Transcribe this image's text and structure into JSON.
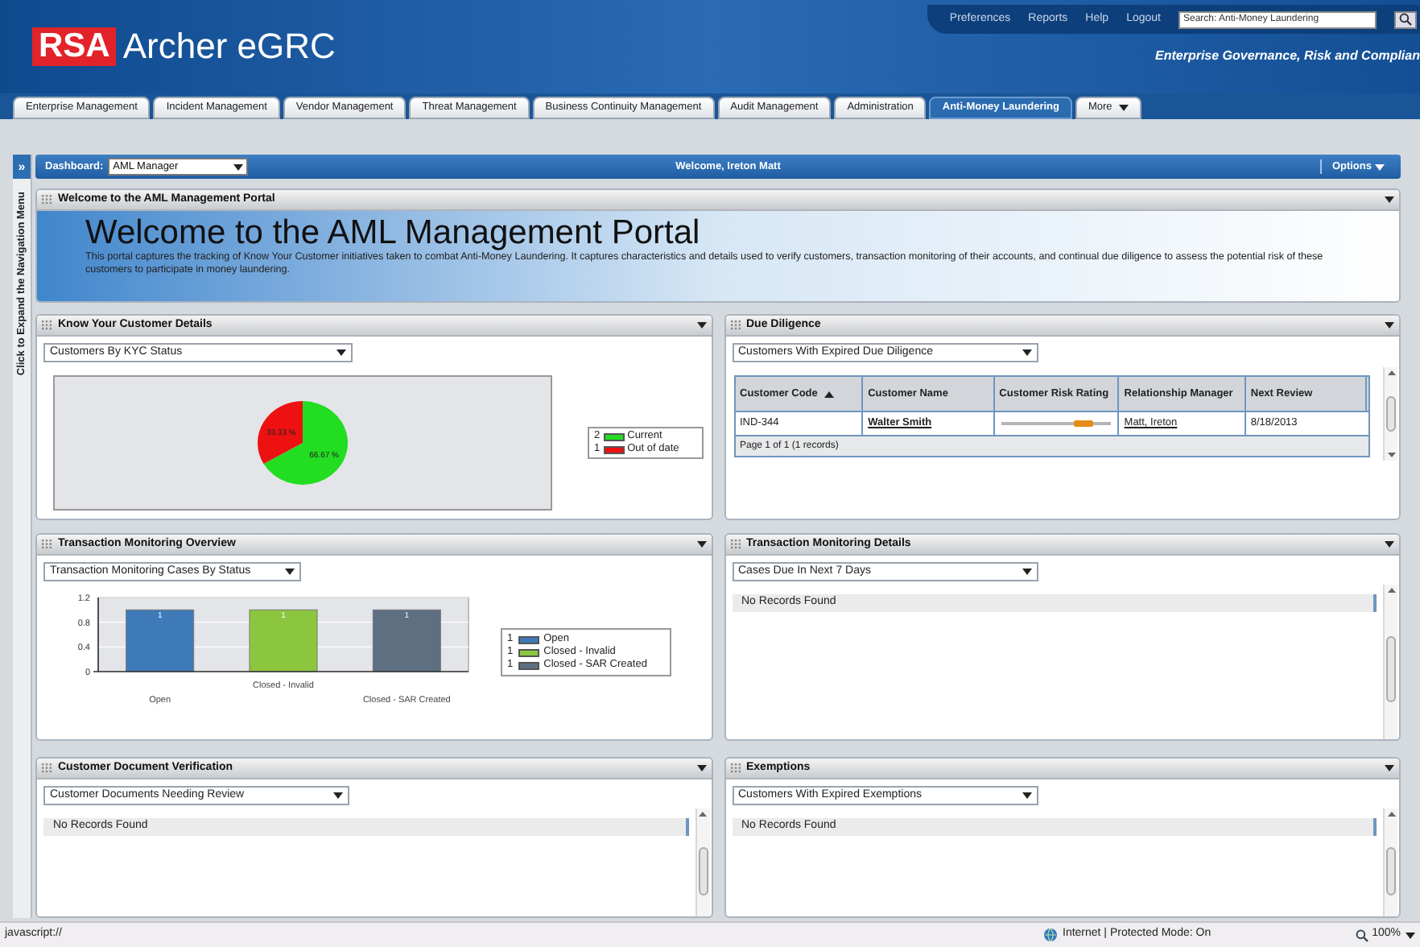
{
  "header": {
    "logo_mark": "RSA",
    "logo_name": "Archer eGRC",
    "links": [
      "Preferences",
      "Reports",
      "Help",
      "Logout"
    ],
    "search": {
      "value": "Search: Anti-Money Laundering"
    },
    "tagline": "Enterprise Governance, Risk and Complian"
  },
  "tabs": [
    {
      "label": "Enterprise Management",
      "kind": "tab",
      "selected": false
    },
    {
      "label": "Incident Management",
      "kind": "tab",
      "selected": false
    },
    {
      "label": "Vendor Management",
      "kind": "tab",
      "selected": false
    },
    {
      "label": "Threat Management",
      "kind": "tab",
      "selected": false
    },
    {
      "label": "Business Continuity Management",
      "kind": "tab",
      "selected": false
    },
    {
      "label": "Audit Management",
      "kind": "tab",
      "selected": false
    },
    {
      "label": "Administration",
      "kind": "tab",
      "selected": false
    },
    {
      "label": "Anti-Money Laundering",
      "kind": "tab",
      "selected": true
    },
    {
      "label": "More",
      "kind": "menu",
      "selected": false
    }
  ],
  "nav_strip": {
    "toggle": "»",
    "label": "Click to Expand the Navigation Menu"
  },
  "dashboard_bar": {
    "label": "Dashboard:",
    "dashboard": "AML Manager",
    "welcome": "Welcome, Ireton Matt",
    "options": "Options"
  },
  "welcome_panel": {
    "title": "Welcome to the AML Management Portal",
    "heading": "Welcome to the AML Management Portal",
    "text": "This portal captures the tracking of Know Your Customer initiatives taken to combat Anti-Money Laundering. It captures characteristics and details used to verify customers, transaction monitoring of their accounts, and continual due diligence to assess the potential risk of these customers to participate in money laundering."
  },
  "panels": [
    {
      "title": "Know Your Customer Details",
      "dropdown": "Customers By KYC Status",
      "kind": "pie_chart",
      "chart_data": {
        "type": "pie",
        "categories": [
          "Current",
          "Out of date"
        ],
        "values": [
          66.67,
          33.33
        ],
        "colors": [
          "#22dd22",
          "#ee1111"
        ],
        "value_labels": [
          "66.67 %",
          "33.33 %"
        ]
      },
      "legend_counts": [
        "2",
        "1"
      ]
    },
    {
      "title": "Due Diligence",
      "dropdown": "Customers With Expired Due Diligence",
      "kind": "table",
      "table": {
        "columns": [
          {
            "label": "Customer Code",
            "sorted": true
          },
          {
            "label": "Customer Name",
            "sorted": false
          },
          {
            "label": "Customer Risk Rating",
            "sorted": false
          },
          {
            "label": "Relationship Manager",
            "sorted": false
          },
          {
            "label": "Next Review",
            "sorted": false
          }
        ],
        "rows": [
          {
            "code": "IND-344",
            "name": "Walter Smith",
            "level": 0.75,
            "manager": "Matt, Ireton",
            "next_review": "8/18/2013"
          }
        ],
        "footer": "Page 1 of 1 (1 records)"
      }
    },
    {
      "title": "Transaction Monitoring Overview",
      "dropdown": "Transaction Monitoring Cases By Status",
      "kind": "bar_chart",
      "chart_data": {
        "type": "bar",
        "categories": [
          "Open",
          "Closed - Invalid",
          "Closed - SAR Created"
        ],
        "series": [
          {
            "name": "Open",
            "color": "#3f7ab8",
            "values": [
              1,
              null,
              null
            ]
          },
          {
            "name": "Closed - Invalid",
            "color": "#8cc63f",
            "values": [
              null,
              1,
              null
            ]
          },
          {
            "name": "Closed - SAR Created",
            "color": "#5e6f82",
            "values": [
              null,
              null,
              1
            ]
          }
        ],
        "ylim": [
          0,
          1.2
        ],
        "yticks": [
          0,
          0.4,
          0.8,
          1.2
        ],
        "data_labels": true
      },
      "legend_counts": [
        "1",
        "1",
        "1"
      ]
    },
    {
      "title": "Transaction Monitoring Details",
      "dropdown": "Cases Due In Next 7 Days",
      "kind": "list",
      "message": "No Records Found"
    },
    {
      "title": "Customer Document Verification",
      "dropdown": "Customer Documents Needing Review",
      "kind": "list",
      "message": "No Records Found"
    },
    {
      "title": "Exemptions",
      "dropdown": "Customers With Expired Exemptions",
      "kind": "list",
      "message": "No Records Found"
    }
  ],
  "status_bar": {
    "url": "javascript://",
    "zone": "Internet | Protected Mode: On",
    "zoom": "100%"
  }
}
